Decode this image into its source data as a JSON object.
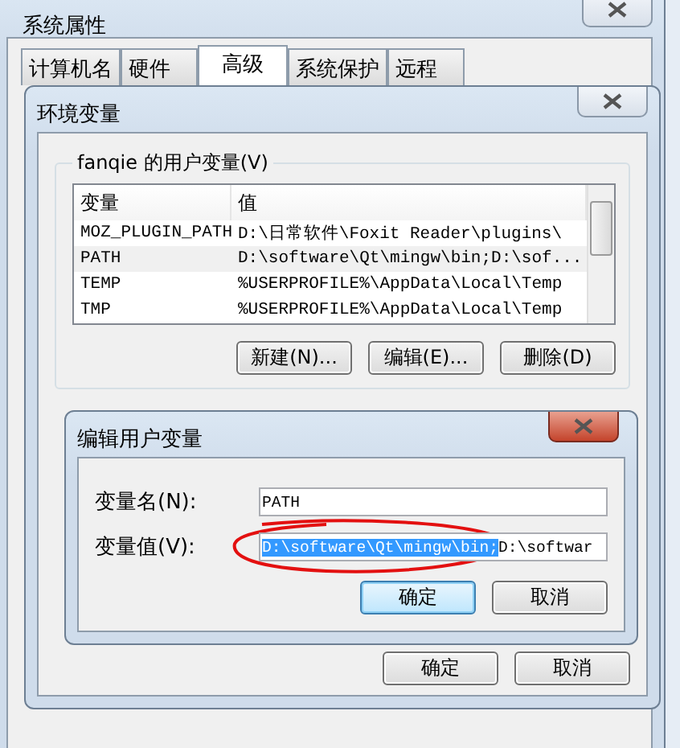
{
  "system_window": {
    "title": "系统属性",
    "tabs": [
      {
        "label": "计算机名",
        "selected": false
      },
      {
        "label": "硬件",
        "selected": false
      },
      {
        "label": "高级",
        "selected": true
      },
      {
        "label": "系统保护",
        "selected": false
      },
      {
        "label": "远程",
        "selected": false
      }
    ]
  },
  "env_dialog": {
    "title": "环境变量",
    "group_label": "fanqie 的用户变量(V)",
    "columns": [
      "变量",
      "值"
    ],
    "rows": [
      {
        "name": "MOZ_PLUGIN_PATH",
        "value": "D:\\日常软件\\Foxit Reader\\plugins\\",
        "selected": false
      },
      {
        "name": "PATH",
        "value": "D:\\software\\Qt\\mingw\\bin;D:\\sof...",
        "selected": true
      },
      {
        "name": "TEMP",
        "value": "%USERPROFILE%\\AppData\\Local\\Temp",
        "selected": false
      },
      {
        "name": "TMP",
        "value": "%USERPROFILE%\\AppData\\Local\\Temp",
        "selected": false
      }
    ],
    "list_buttons": [
      "新建(N)...",
      "编辑(E)...",
      "删除(D)"
    ],
    "buttons": [
      "确定",
      "取消"
    ]
  },
  "edit_dialog": {
    "title": "编辑用户变量",
    "name_label": "变量名(N):",
    "name_value": "PATH",
    "value_label": "变量值(V):",
    "value_selected": "D:\\software\\Qt\\mingw\\bin;",
    "value_rest": "D:\\softwar",
    "buttons": [
      "确定",
      "取消"
    ]
  }
}
